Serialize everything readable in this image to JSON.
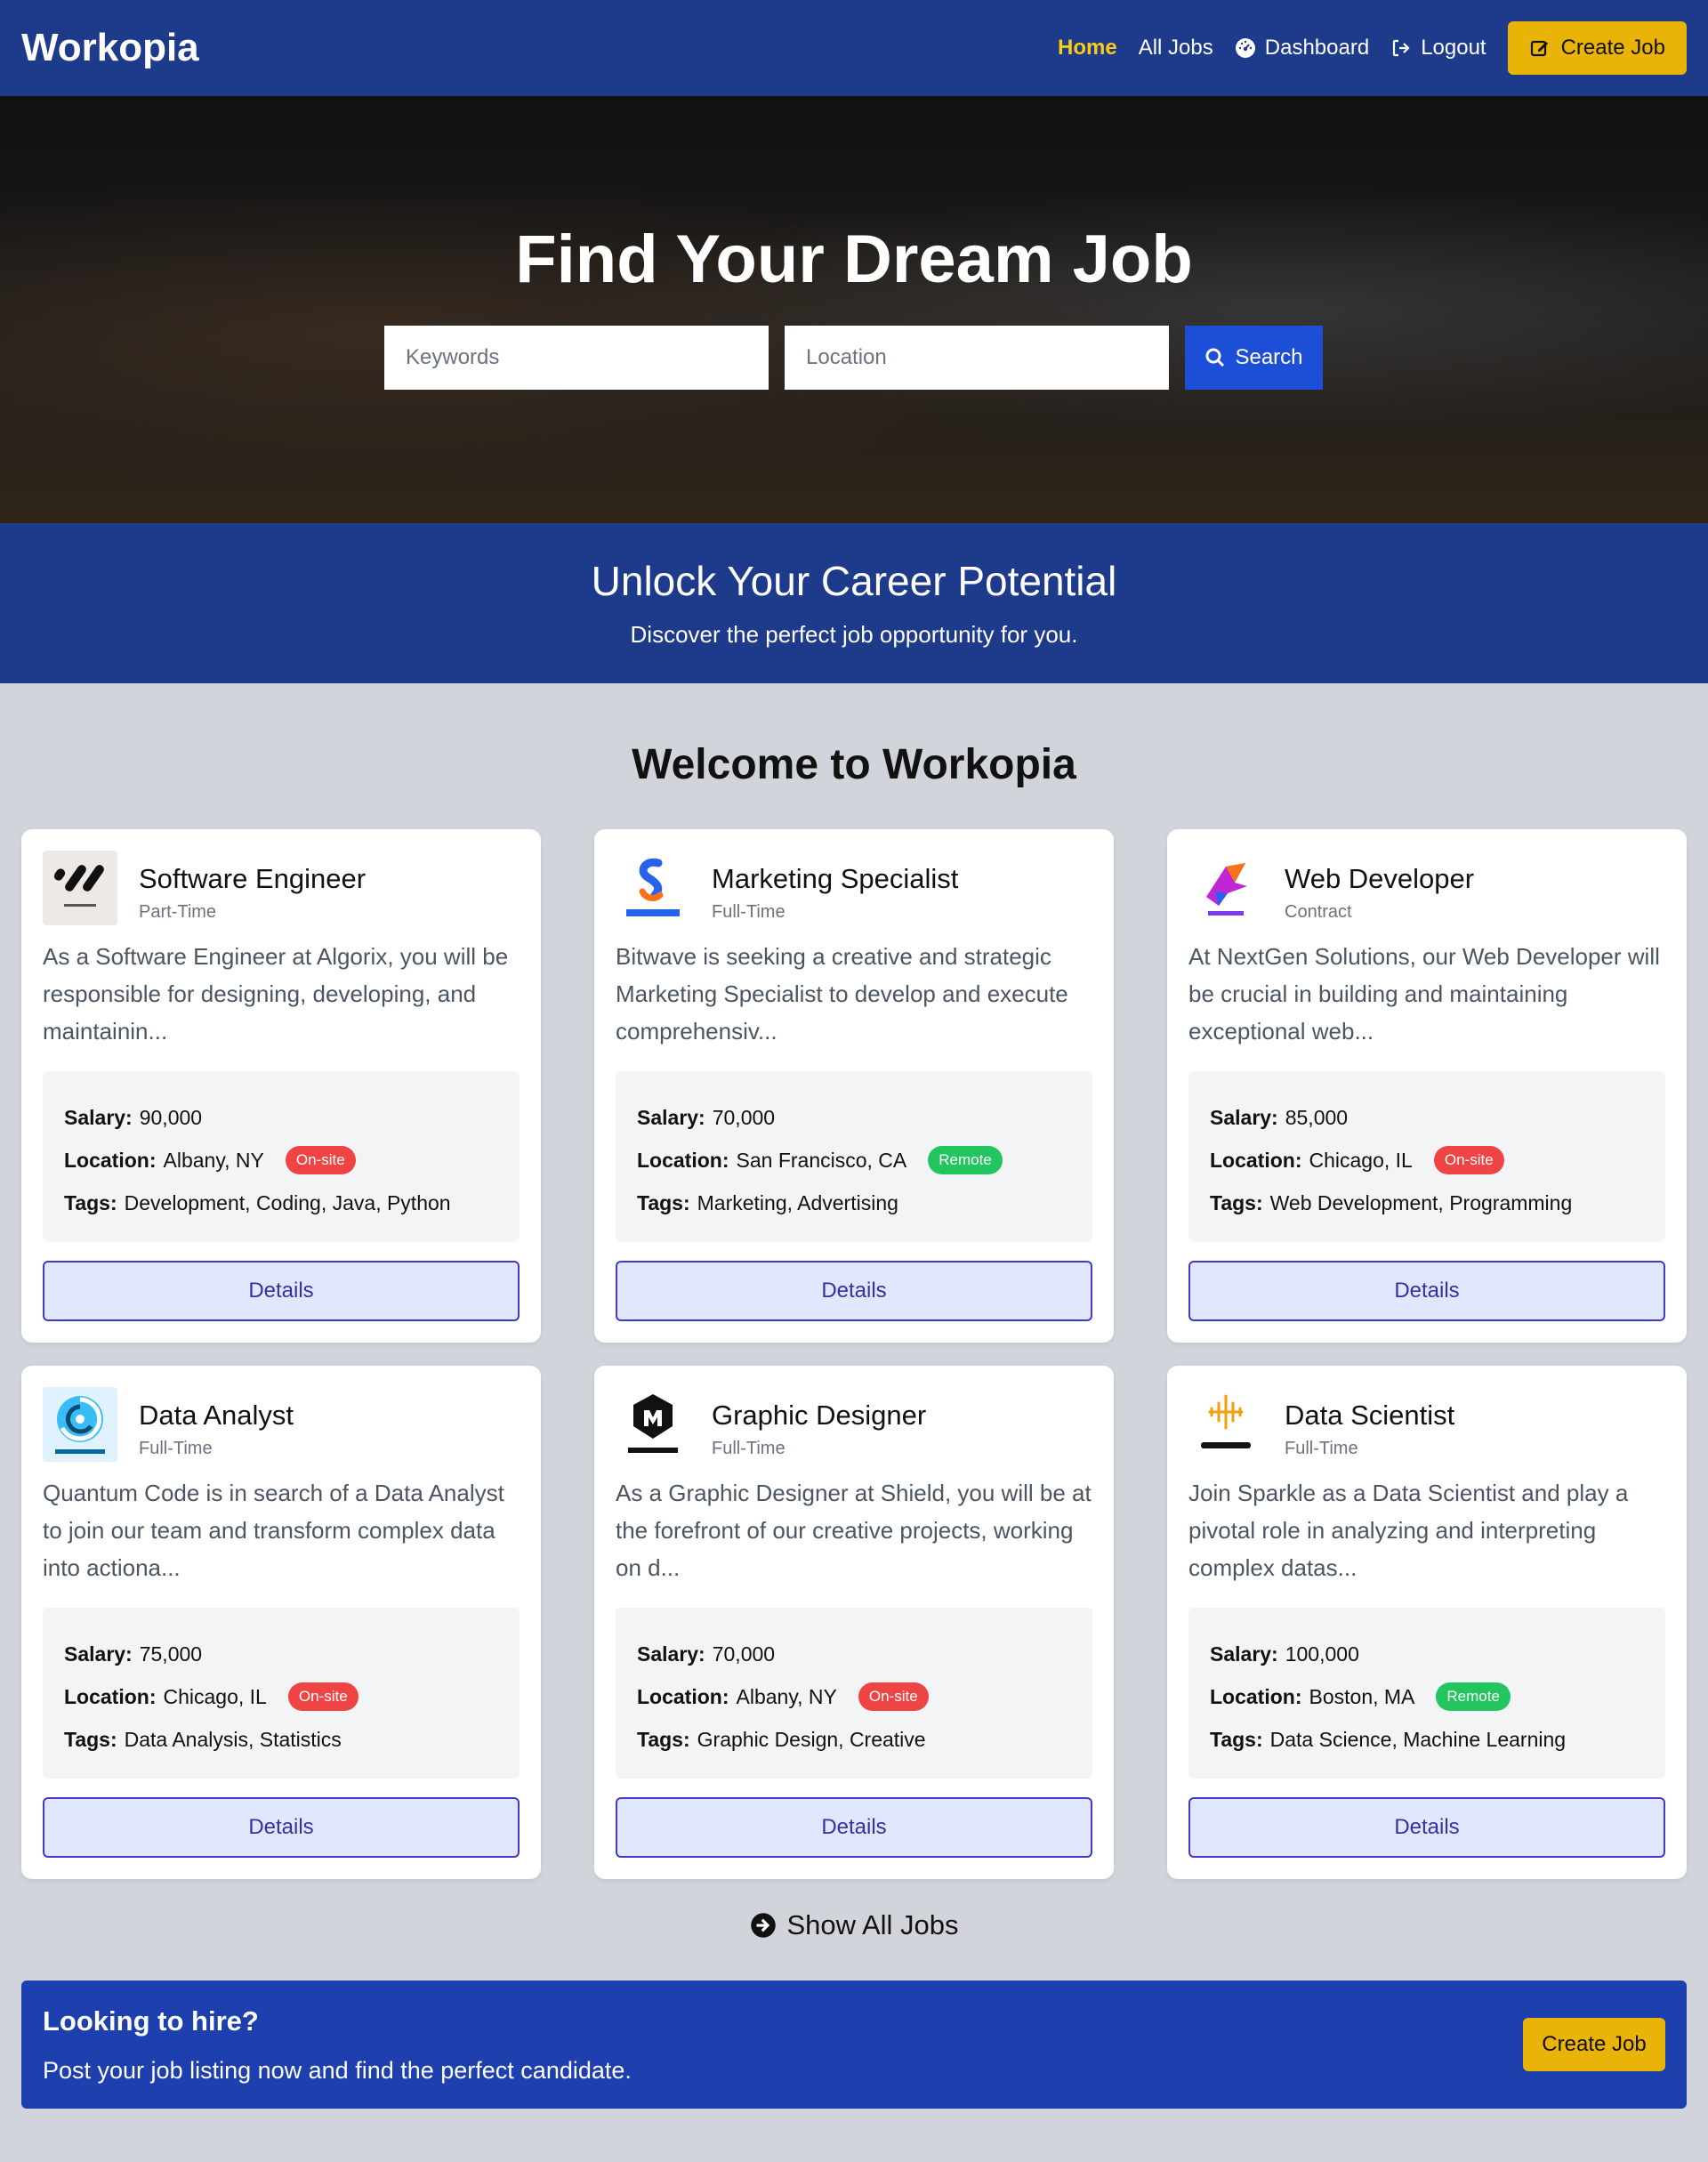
{
  "header": {
    "brand": "Workopia",
    "nav": {
      "home": "Home",
      "all_jobs": "All Jobs",
      "dashboard": "Dashboard",
      "logout": "Logout",
      "create_job": "Create Job"
    }
  },
  "hero": {
    "title": "Find Your Dream Job",
    "keywords_placeholder": "Keywords",
    "location_placeholder": "Location",
    "search_label": "Search"
  },
  "banner": {
    "title": "Unlock Your Career Potential",
    "subtitle": "Discover the perfect job opportunity for you."
  },
  "welcome": "Welcome to Workopia",
  "labels": {
    "salary": "Salary:",
    "location": "Location:",
    "tags": "Tags:",
    "details": "Details"
  },
  "jobs": [
    {
      "title": "Software Engineer",
      "type": "Part-Time",
      "logo": "ALGORIX",
      "description": "As a Software Engineer at Algorix, you will be responsible for designing, developing, and maintainin...",
      "salary": "90,000",
      "location": "Albany, NY",
      "mode": "On-site",
      "tags": "Development, Coding, Java, Python"
    },
    {
      "title": "Marketing Specialist",
      "type": "Full-Time",
      "logo": "BITWAVE",
      "description": "Bitwave is seeking a creative and strategic Marketing Specialist to develop and execute comprehensiv...",
      "salary": "70,000",
      "location": "San Francisco, CA",
      "mode": "Remote",
      "tags": "Marketing, Advertising"
    },
    {
      "title": "Web Developer",
      "type": "Contract",
      "logo": "NEXTGEN",
      "description": "At NextGen Solutions, our Web Developer will be crucial in building and maintaining exceptional web...",
      "salary": "85,000",
      "location": "Chicago, IL",
      "mode": "On-site",
      "tags": "Web Development, Programming"
    },
    {
      "title": "Data Analyst",
      "type": "Full-Time",
      "logo": "QUANTUMCODE",
      "description": "Quantum Code is in search of a Data Analyst to join our team and transform complex data into actiona...",
      "salary": "75,000",
      "location": "Chicago, IL",
      "mode": "On-site",
      "tags": "Data Analysis, Statistics"
    },
    {
      "title": "Graphic Designer",
      "type": "Full-Time",
      "logo": "SHIELD",
      "description": "As a Graphic Designer at Shield, you will be at the forefront of our creative projects, working on d...",
      "salary": "70,000",
      "location": "Albany, NY",
      "mode": "On-site",
      "tags": "Graphic Design, Creative"
    },
    {
      "title": "Data Scientist",
      "type": "Full-Time",
      "logo": "sparkle",
      "description": "Join Sparkle as a Data Scientist and play a pivotal role in analyzing and interpreting complex datas...",
      "salary": "100,000",
      "location": "Boston, MA",
      "mode": "Remote",
      "tags": "Data Science, Machine Learning"
    }
  ],
  "show_all": "Show All Jobs",
  "hire": {
    "title": "Looking to hire?",
    "text": "Post your job listing now and find the perfect candidate.",
    "button": "Create Job"
  },
  "colors": {
    "navy": "#1e3a8a",
    "accent_yellow": "#eab308",
    "search_blue": "#1d4ed8",
    "onsite_red": "#ef4444",
    "remote_green": "#22c55e"
  }
}
